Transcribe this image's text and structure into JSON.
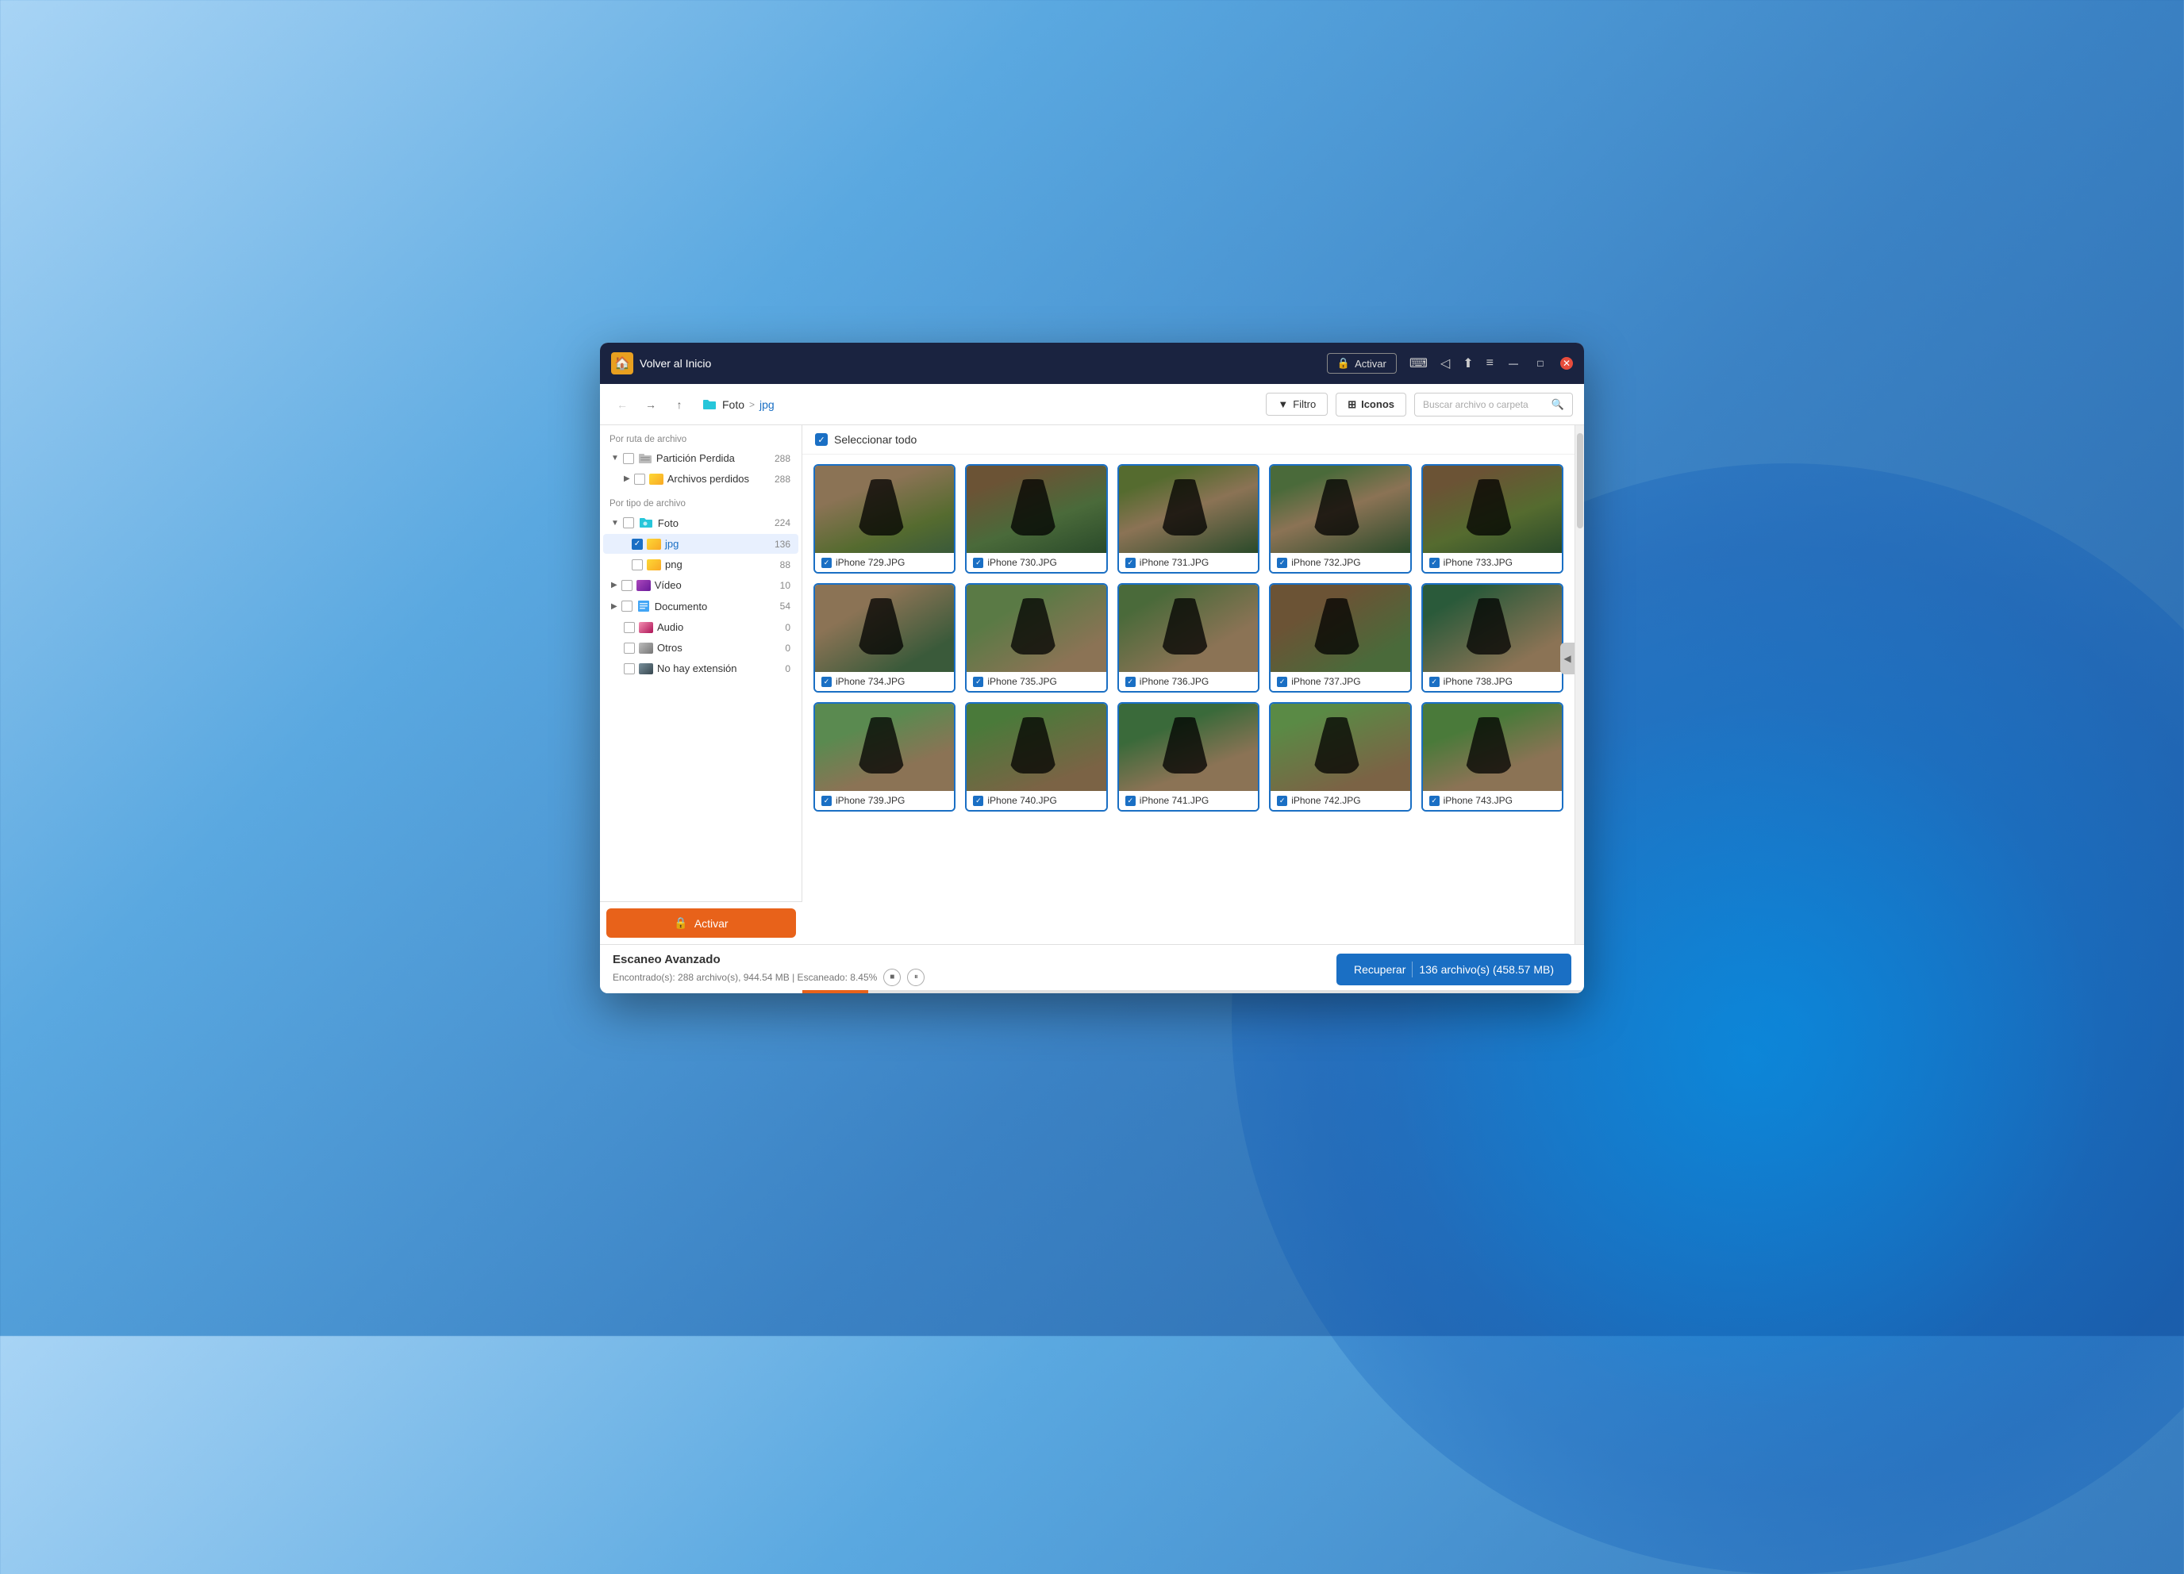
{
  "titleBar": {
    "homeLabel": "Volver al Inicio",
    "activateLabel": "Activar",
    "lockIcon": "🔒",
    "windowControls": {
      "minimize": "—",
      "maximize": "□",
      "close": "✕"
    }
  },
  "toolbar": {
    "breadcrumb": {
      "root": "Foto",
      "separator": ">",
      "current": "jpg"
    },
    "filterLabel": "Filtro",
    "iconsLabel": "Iconos",
    "searchPlaceholder": "Buscar archivo o carpeta"
  },
  "sidebar": {
    "byPathLabel": "Por ruta de archivo",
    "byTypeLabel": "Por tipo de archivo",
    "items": [
      {
        "name": "Partición Perdida",
        "count": "288",
        "expanded": true,
        "checked": false,
        "type": "partition"
      },
      {
        "name": "Archivos perdidos",
        "count": "288",
        "checked": false,
        "type": "folder-yellow"
      },
      {
        "name": "Foto",
        "count": "224",
        "expanded": true,
        "checked": false,
        "type": "folder-teal"
      },
      {
        "name": "jpg",
        "count": "136",
        "checked": true,
        "type": "folder-yellow",
        "active": true
      },
      {
        "name": "png",
        "count": "88",
        "checked": false,
        "type": "folder-yellow"
      },
      {
        "name": "Vídeo",
        "count": "10",
        "checked": false,
        "type": "folder-blue"
      },
      {
        "name": "Documento",
        "count": "54",
        "checked": false,
        "type": "folder-purple"
      },
      {
        "name": "Audio",
        "count": "0",
        "checked": false,
        "type": "folder-pink"
      },
      {
        "name": "Otros",
        "count": "0",
        "checked": false,
        "type": "folder-gray"
      },
      {
        "name": "No hay extensión",
        "count": "0",
        "checked": false,
        "type": "folder-dark"
      }
    ]
  },
  "content": {
    "selectAllLabel": "Seleccionar todo",
    "photos": [
      {
        "name": "iPhone 729.JPG",
        "colorClass": "p1"
      },
      {
        "name": "iPhone 730.JPG",
        "colorClass": "p2"
      },
      {
        "name": "iPhone 731.JPG",
        "colorClass": "p3"
      },
      {
        "name": "iPhone 732.JPG",
        "colorClass": "p4"
      },
      {
        "name": "iPhone 733.JPG",
        "colorClass": "p5"
      },
      {
        "name": "iPhone 734.JPG",
        "colorClass": "p6"
      },
      {
        "name": "iPhone 735.JPG",
        "colorClass": "p7"
      },
      {
        "name": "iPhone 736.JPG",
        "colorClass": "p8"
      },
      {
        "name": "iPhone 737.JPG",
        "colorClass": "p9"
      },
      {
        "name": "iPhone 738.JPG",
        "colorClass": "p10"
      },
      {
        "name": "iPhone 739.JPG",
        "colorClass": "p11"
      },
      {
        "name": "iPhone 740.JPG",
        "colorClass": "p12"
      },
      {
        "name": "iPhone 741.JPG",
        "colorClass": "p13"
      },
      {
        "name": "iPhone 742.JPG",
        "colorClass": "p14"
      },
      {
        "name": "iPhone 743.JPG",
        "colorClass": "p15"
      }
    ]
  },
  "statusBar": {
    "title": "Escaneo Avanzado",
    "description": "Encontrado(s): 288 archivo(s), 944.54 MB | Escaneado: 8.45%",
    "recoverLabel": "Recuperar",
    "recoverCount": "136 archivo(s) (458.57 MB)"
  },
  "activateButton": {
    "label": "Activar"
  }
}
